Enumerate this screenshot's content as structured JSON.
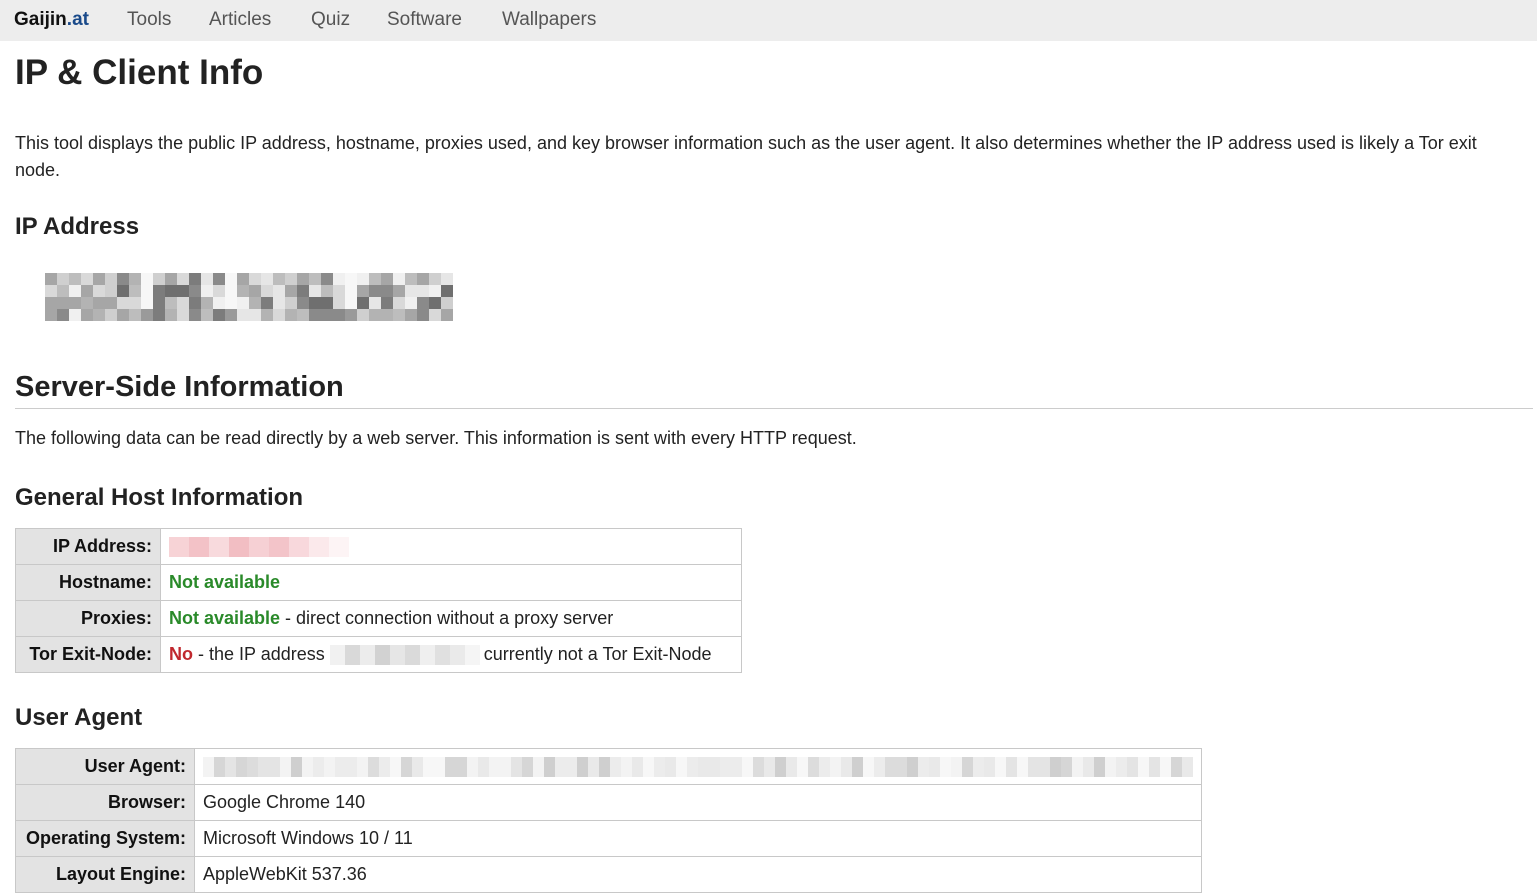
{
  "nav": {
    "brand_main": "Gaijin",
    "brand_suffix": ".at",
    "items": [
      {
        "label": "Tools"
      },
      {
        "label": "Articles"
      },
      {
        "label": "Quiz"
      },
      {
        "label": "Software"
      },
      {
        "label": "Wallpapers"
      }
    ]
  },
  "page": {
    "title": "IP & Client Info",
    "intro": "This tool displays the public IP address, hostname, proxies used, and key browser information such as the user agent. It also determines whether the IP address used is likely a Tor exit node.",
    "ip_heading": "IP Address"
  },
  "server": {
    "title": "Server-Side Information",
    "description": "The following data can be read directly by a web server. This information is sent with every HTTP request.",
    "host_heading": "General Host Information",
    "host_rows": {
      "ip_label": "IP Address:",
      "hostname_label": "Hostname:",
      "hostname_value": "Not available",
      "proxies_label": "Proxies:",
      "proxies_value": "Not available",
      "proxies_note": " - direct connection without a proxy server",
      "tor_label": "Tor Exit-Node:",
      "tor_value": "No",
      "tor_note_pre": " - the IP address ",
      "tor_note_post": "currently not a Tor Exit-Node"
    },
    "ua_heading": "User Agent",
    "ua_rows": {
      "ua_label": "User Agent:",
      "browser_label": "Browser:",
      "browser_value": "Google Chrome 140",
      "os_label": "Operating System:",
      "os_value": "Microsoft Windows 10 / 11",
      "engine_label": "Layout Engine:",
      "engine_value": "AppleWebKit 537.36"
    }
  },
  "colors": {
    "nav_bg": "#ededed",
    "ok_green": "#2a8a2a",
    "no_red": "#c0282e",
    "header_cell_bg": "#e3e3e3"
  }
}
